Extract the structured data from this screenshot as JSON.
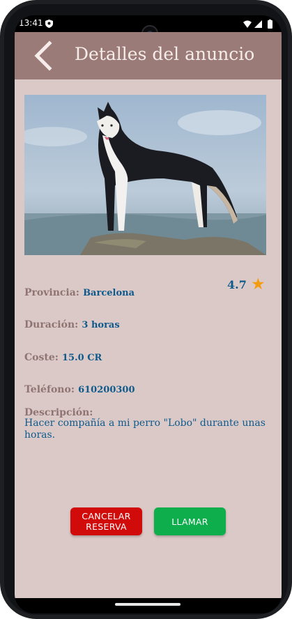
{
  "status_bar": {
    "time": "13:41"
  },
  "app_bar": {
    "title": "Detalles del anuncio",
    "back_icon": "chevron-left-icon"
  },
  "listing": {
    "image_alt": "husky dog on rock",
    "province": {
      "label": "Provincia:",
      "value": "Barcelona"
    },
    "rating": {
      "value": "4.7",
      "icon": "star-icon",
      "color": "#f39c12"
    },
    "duration": {
      "label": "Duración:",
      "value": "3 horas"
    },
    "cost": {
      "label": "Coste:",
      "value": "15.0 CR"
    },
    "phone": {
      "label": "Teléfono:",
      "value": "610200300"
    },
    "description": {
      "label": "Descripción:",
      "value": "Hacer compañía a mi perro \"Lobo\" durante unas horas."
    }
  },
  "actions": {
    "cancel_label": "CANCELAR\nRESERVA",
    "call_label": "LLAMAR",
    "cancel_color": "#d10a0a",
    "call_color": "#0fae4c"
  },
  "colors": {
    "app_bar": "#9a7b78",
    "background": "#dbc9c7",
    "label": "#8f7472",
    "value": "#0f5a8c"
  }
}
